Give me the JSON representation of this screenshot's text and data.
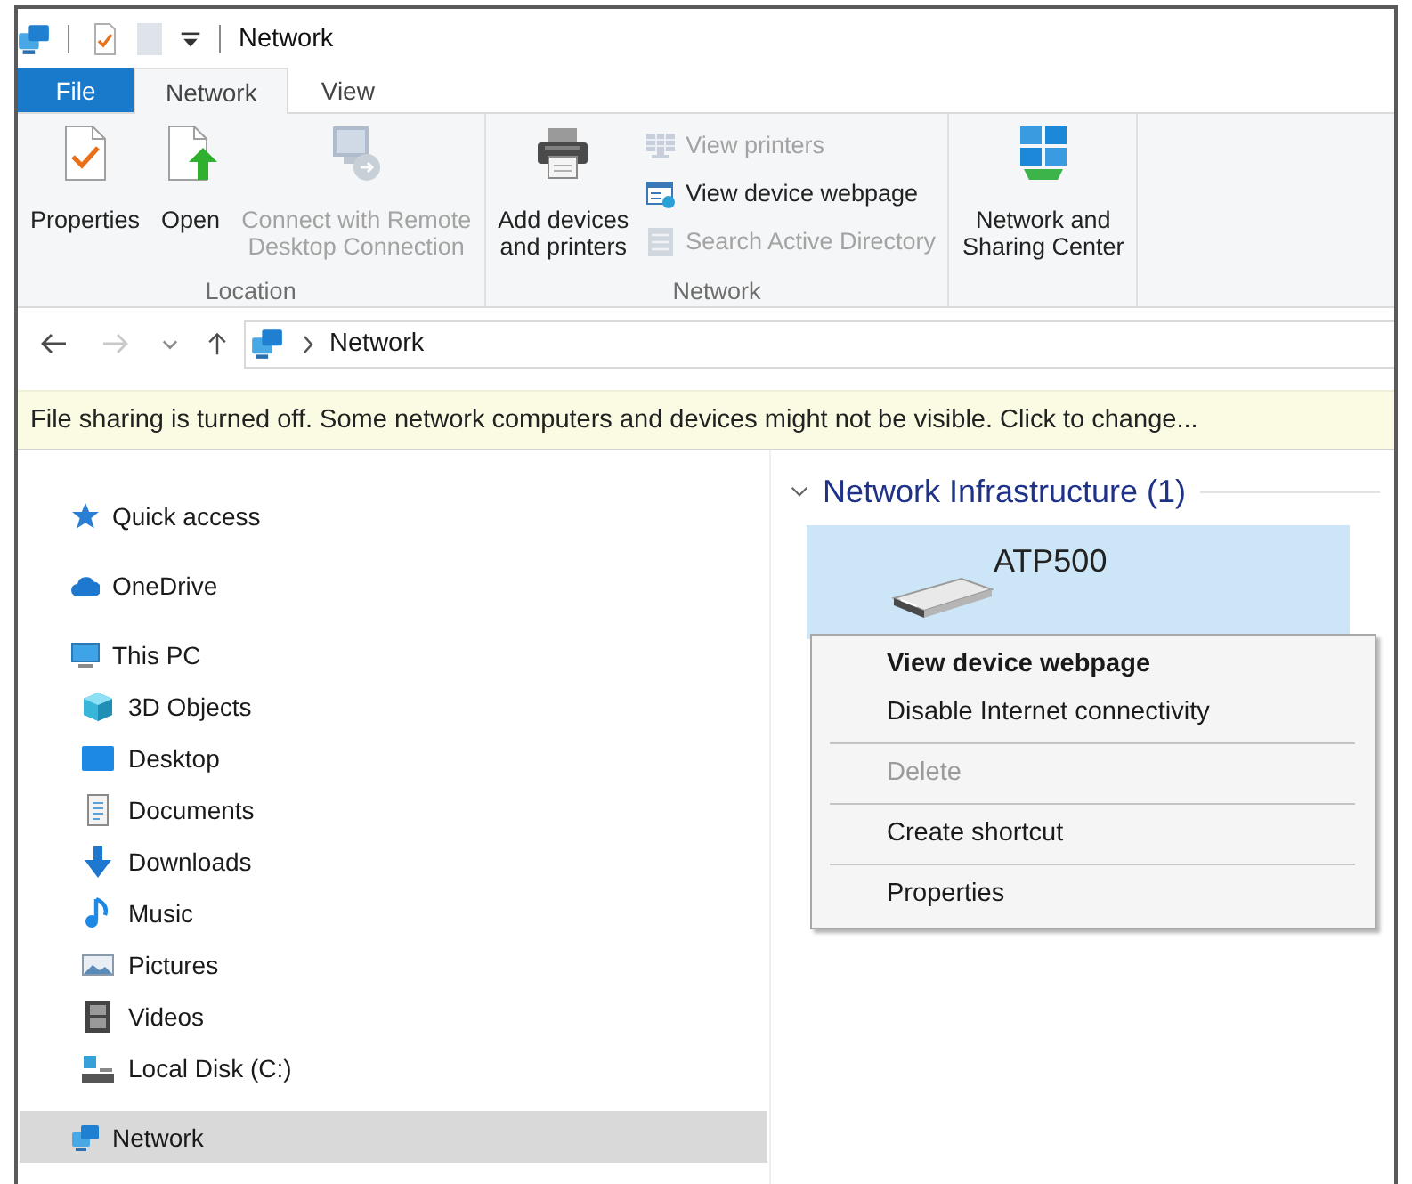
{
  "window": {
    "title": "Network"
  },
  "ribbon_tabs": [
    {
      "label": "File",
      "kind": "file",
      "selected": false
    },
    {
      "label": "Network",
      "kind": "tab",
      "selected": true
    },
    {
      "label": "View",
      "kind": "tab",
      "selected": false
    }
  ],
  "ribbon_groups": [
    {
      "label": "Location",
      "commands": [
        {
          "label": "Properties",
          "kind": "large",
          "disabled": false
        },
        {
          "label": "Open",
          "kind": "large",
          "disabled": false
        },
        {
          "label": "Connect with Remote\nDesktop Connection",
          "kind": "large",
          "disabled": true
        }
      ]
    },
    {
      "label": "Network",
      "commands": [
        {
          "label": "Add devices\nand printers",
          "kind": "large",
          "disabled": false
        },
        {
          "label": "View printers",
          "kind": "small",
          "disabled": true
        },
        {
          "label": "View device webpage",
          "kind": "small",
          "disabled": false
        },
        {
          "label": "Search Active Directory",
          "kind": "small",
          "disabled": true
        }
      ]
    },
    {
      "commands": [
        {
          "label": "Network and\nSharing Center",
          "kind": "large",
          "disabled": false
        }
      ]
    }
  ],
  "navigation": [
    {
      "kind": "back",
      "disabled": false
    },
    {
      "kind": "forward",
      "disabled": true
    },
    {
      "kind": "recent",
      "disabled": false
    },
    {
      "kind": "up",
      "disabled": false
    }
  ],
  "address": {
    "breadcrumbs": [
      "Network"
    ]
  },
  "notice": {
    "text": "File sharing is turned off. Some network computers and devices might not be visible. Click to change..."
  },
  "sidebar": {
    "items": [
      {
        "label": "Quick access",
        "selected": false
      },
      {
        "label": "OneDrive",
        "selected": false
      },
      {
        "label": "This PC",
        "selected": false,
        "children": [
          {
            "label": "3D Objects",
            "selected": false
          },
          {
            "label": "Desktop",
            "selected": false
          },
          {
            "label": "Documents",
            "selected": false
          },
          {
            "label": "Downloads",
            "selected": false
          },
          {
            "label": "Music",
            "selected": false
          },
          {
            "label": "Pictures",
            "selected": false
          },
          {
            "label": "Videos",
            "selected": false
          },
          {
            "label": "Local Disk (C:)",
            "selected": false
          }
        ]
      },
      {
        "label": "Network",
        "selected": true
      }
    ]
  },
  "content": {
    "groups": [
      {
        "label": "Network Infrastructure (1)",
        "expanded": true,
        "items": [
          {
            "label": "ATP500",
            "selected": true
          }
        ]
      }
    ]
  },
  "context_menu": {
    "items": [
      {
        "kind": "item",
        "label": "View device webpage",
        "default": true,
        "disabled": false
      },
      {
        "kind": "item",
        "label": "Disable Internet connectivity",
        "default": false,
        "disabled": false
      },
      {
        "kind": "separator"
      },
      {
        "kind": "item",
        "label": "Delete",
        "default": false,
        "disabled": true
      },
      {
        "kind": "separator"
      },
      {
        "kind": "item",
        "label": "Create shortcut",
        "default": false,
        "disabled": false
      },
      {
        "kind": "separator"
      },
      {
        "kind": "item",
        "label": "Properties",
        "default": false,
        "disabled": false
      }
    ]
  }
}
